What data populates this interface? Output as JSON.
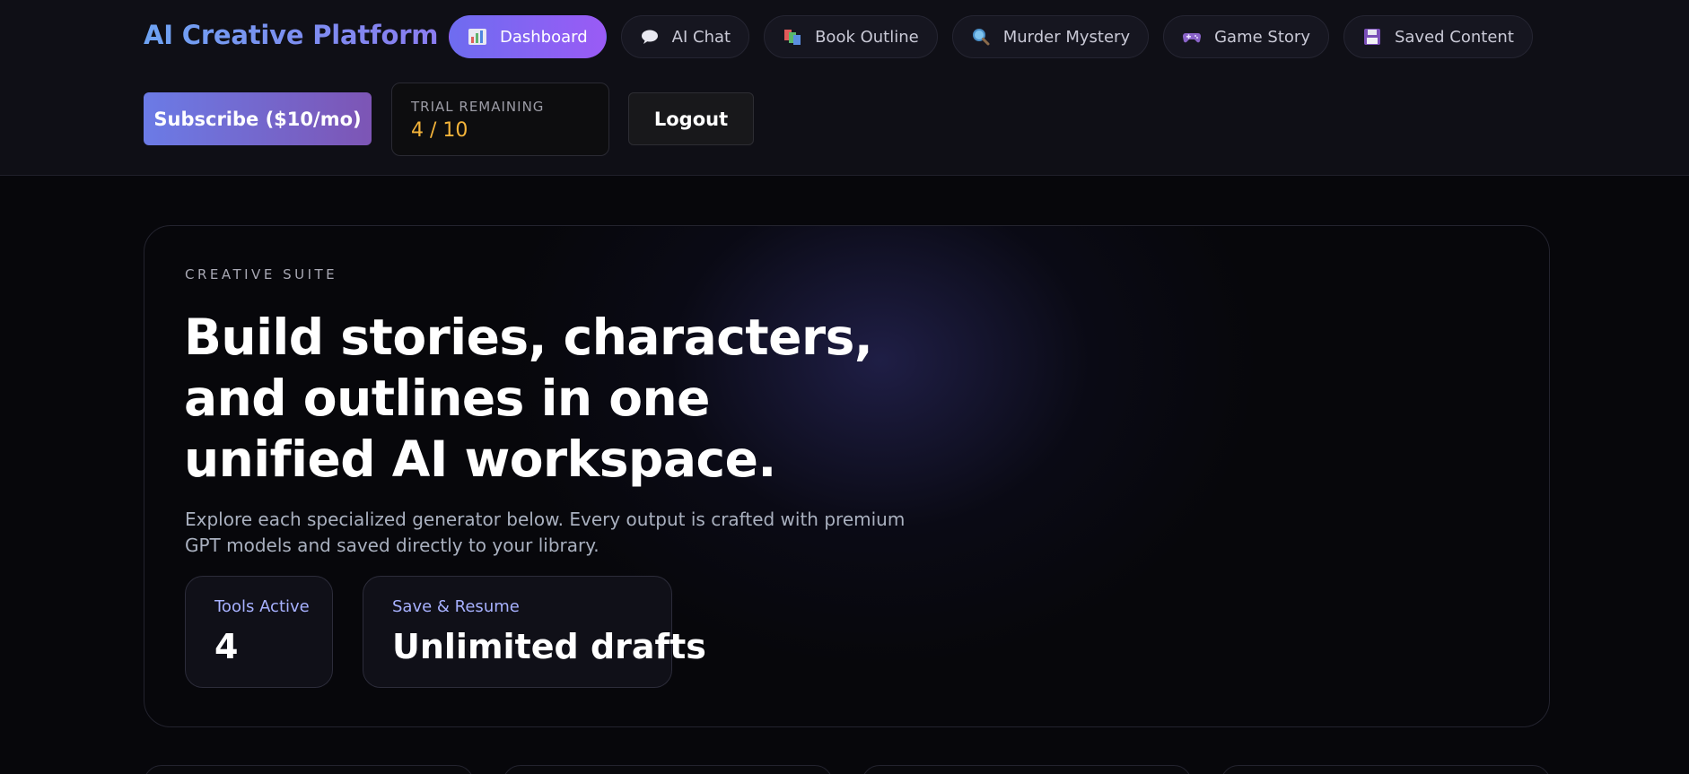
{
  "app": {
    "title": "AI Creative Platform"
  },
  "nav": {
    "items": [
      {
        "label": "Dashboard",
        "icon": "bar-chart-icon",
        "active": true
      },
      {
        "label": "AI Chat",
        "icon": "speech-bubble-icon",
        "active": false
      },
      {
        "label": "Book Outline",
        "icon": "books-icon",
        "active": false
      },
      {
        "label": "Murder Mystery",
        "icon": "magnifier-icon",
        "active": false
      },
      {
        "label": "Game Story",
        "icon": "gamepad-icon",
        "active": false
      },
      {
        "label": "Saved Content",
        "icon": "floppy-disk-icon",
        "active": false
      }
    ]
  },
  "account": {
    "subscribe_label": "Subscribe ($10/mo)",
    "trial_label": "TRIAL REMAINING",
    "trial_value": "4 / 10",
    "logout_label": "Logout"
  },
  "hero": {
    "eyebrow": "CREATIVE SUITE",
    "headline": "Build stories, characters, and outlines in one unified AI workspace.",
    "description": "Explore each specialized generator below. Every output is crafted with premium GPT models and saved directly to your library.",
    "stats": [
      {
        "label": "Tools Active",
        "value": "4"
      },
      {
        "label": "Save & Resume",
        "value": "Unlimited drafts"
      }
    ]
  },
  "colors": {
    "accent_start": "#6e6cf0",
    "accent_end": "#9a5bf5",
    "trial_value": "#f4b43a",
    "stat_label": "#a7b1ff"
  }
}
